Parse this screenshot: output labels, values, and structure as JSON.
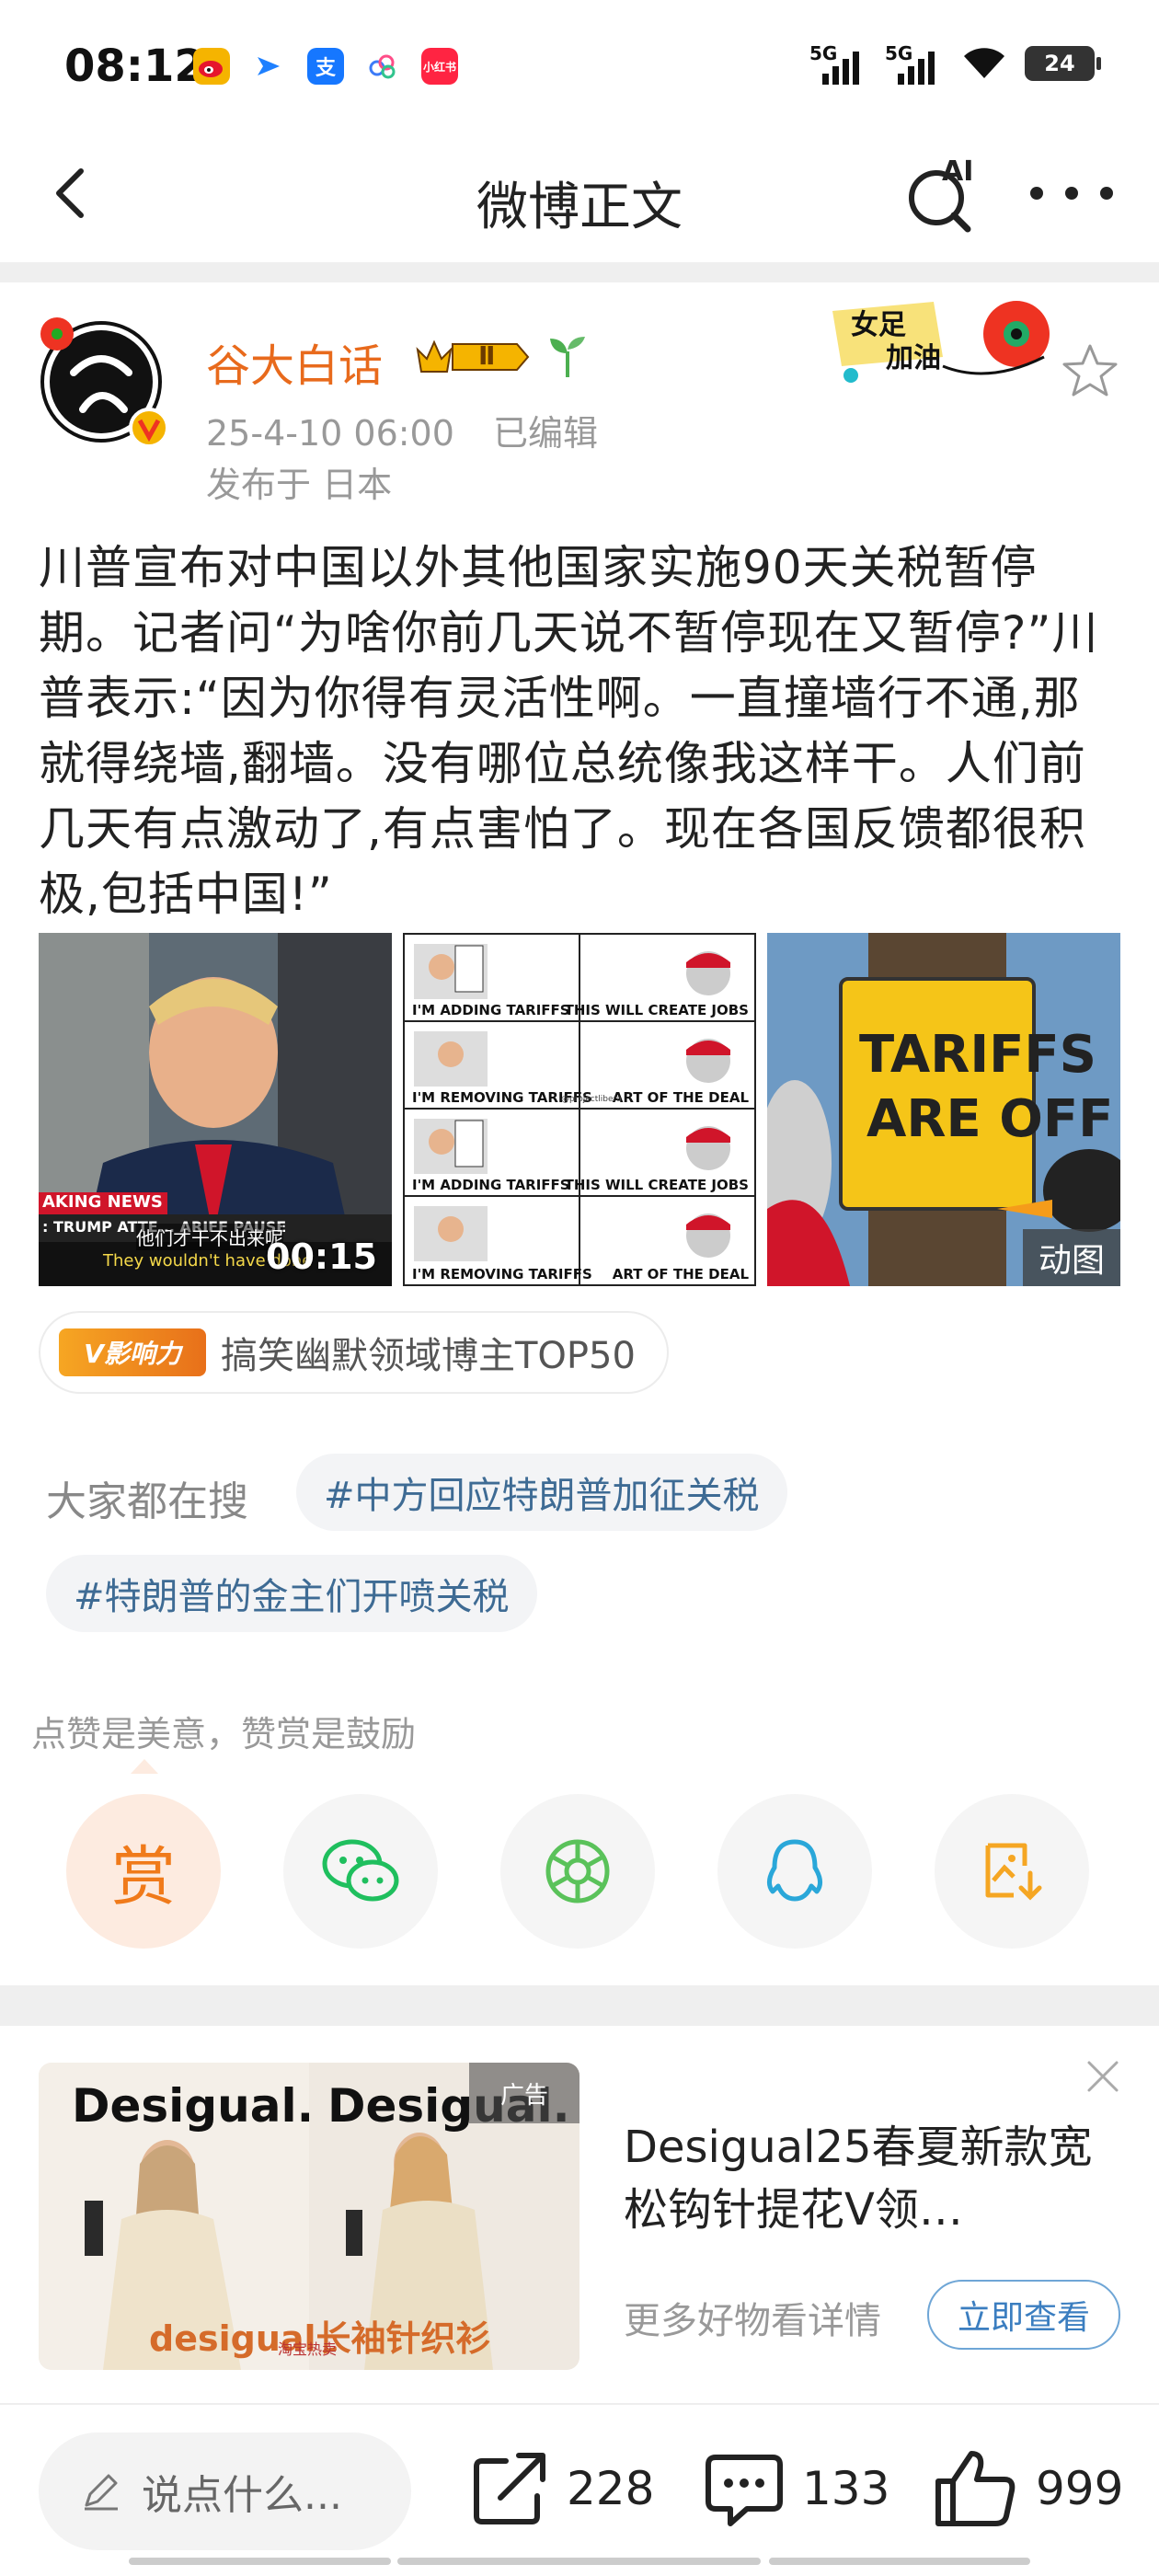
{
  "status_bar": {
    "time": "08:12",
    "signal_1": "5G",
    "signal_2": "5G",
    "battery": "24",
    "app_icons": [
      "weibo-icon",
      "video-icon",
      "alipay-icon",
      "cloud-icon",
      "xiaohongshu-icon"
    ],
    "app_icon_text": {
      "alipay": "支",
      "xiaohongshu": "小红书"
    }
  },
  "nav": {
    "title": "微博正文",
    "ai_label": "AI"
  },
  "author": {
    "name": "谷大白话",
    "level": "Ⅱ",
    "timestamp": "25-4-10 06:00",
    "edited": "已编辑",
    "location": "发布于 日本",
    "sticker_text": [
      "女足",
      "加油"
    ]
  },
  "post": {
    "text": "川普宣布对中国以外其他国家实施90天关税暂停期。记者问“为啥你前几天说不暂停现在又暂停?”川普表示:“因为你得有灵活性啊。一直撞墙行不通,那就得绕墙,翻墙。没有哪位总统像我这样干。人们前几天有点激动了,有点害怕了。现在各国反馈都很积极,包括中国!”"
  },
  "media": {
    "video": {
      "duration": "00:15",
      "ticker_red": "AKING NEWS",
      "ticker": ": TRUMP ATTE... ARIFF PAUSE",
      "subtitle_zh": "他们才干不出来呢",
      "subtitle_en": "They wouldn't have done"
    },
    "meme": {
      "rows": [
        {
          "left": "I'M ADDING TARIFFS",
          "right": "THIS WILL CREATE JOBS"
        },
        {
          "left": "I'M REMOVING TARIFFS",
          "right": "ART OF THE DEAL"
        },
        {
          "left": "I'M ADDING TARIFFS",
          "right": "THIS WILL CREATE JOBS"
        },
        {
          "left": "I'M REMOVING TARIFFS",
          "right": "ART OF THE DEAL"
        }
      ],
      "handle": "@projectlibera"
    },
    "gif": {
      "sign_line1": "TARIFFS",
      "sign_line2": "ARE OFF",
      "tag": "动图"
    }
  },
  "influence": {
    "badge": "V影响力",
    "text": "搞笑幽默领域博主TOP50"
  },
  "search": {
    "label": "大家都在搜",
    "chips": [
      "#中方回应特朗普加征关税",
      "#特朗普的金主们开喷关税"
    ]
  },
  "reward": {
    "label": "点赞是美意，赞赏是鼓励",
    "reward_button": "赏",
    "share_icons": [
      "reward-icon",
      "wechat-icon",
      "moments-icon",
      "qq-icon",
      "save-image-icon"
    ]
  },
  "ad": {
    "brand_left": "Desigual.",
    "brand_right": "Desigual.",
    "tag": "广告",
    "image_footer": "desigual长袖针织衫",
    "image_small": "淘宝热卖",
    "title": "Desigual25春夏新款宽松钩针提花V领…",
    "subtitle": "更多好物看详情",
    "cta": "立即查看"
  },
  "bottom_bar": {
    "comment_placeholder": "说点什么...",
    "reposts": "228",
    "comments": "133",
    "likes": "999"
  },
  "colors": {
    "accent_orange": "#e86a1c",
    "link_blue": "#3e6b94",
    "cta_blue": "#3b7ec0",
    "divider": "#efefef"
  }
}
